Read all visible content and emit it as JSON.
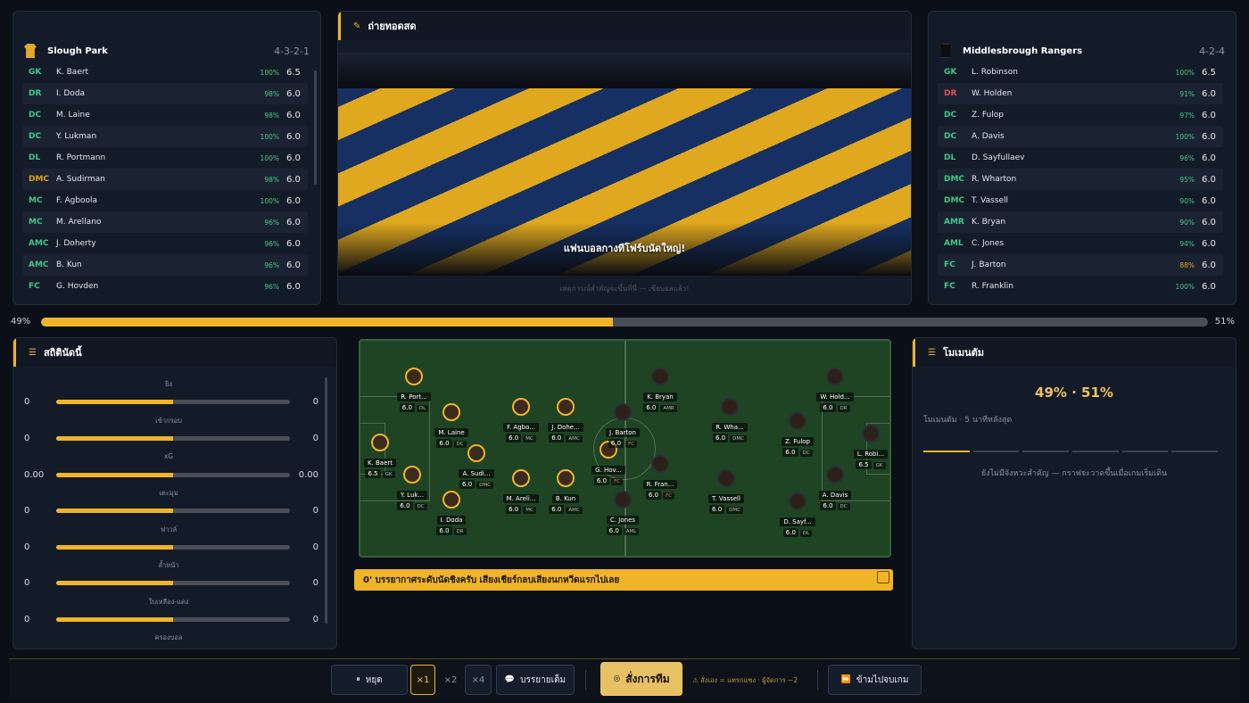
{
  "home": {
    "name": "Slough Park",
    "formation": "4-3-2-1",
    "players": [
      {
        "pos": "GK",
        "name": "K. Baert",
        "pct": "100%",
        "rating": "6.5",
        "pos_color": "#3ec98a",
        "pct_color": "#3ec98a"
      },
      {
        "pos": "DR",
        "name": "I. Doda",
        "pct": "98%",
        "rating": "6.0",
        "pos_color": "#3ec98a",
        "pct_color": "#3ec98a"
      },
      {
        "pos": "DC",
        "name": "M. Laine",
        "pct": "98%",
        "rating": "6.0",
        "pos_color": "#3ec98a",
        "pct_color": "#3ec98a"
      },
      {
        "pos": "DC",
        "name": "Y. Lukman",
        "pct": "100%",
        "rating": "6.0",
        "pos_color": "#3ec98a",
        "pct_color": "#3ec98a"
      },
      {
        "pos": "DL",
        "name": "R. Portmann",
        "pct": "100%",
        "rating": "6.0",
        "pos_color": "#3ec98a",
        "pct_color": "#3ec98a"
      },
      {
        "pos": "DMC",
        "name": "A. Sudirman",
        "pct": "98%",
        "rating": "6.0",
        "pos_color": "#e0a020",
        "pct_color": "#3ec98a"
      },
      {
        "pos": "MC",
        "name": "F. Agboola",
        "pct": "100%",
        "rating": "6.0",
        "pos_color": "#3ec98a",
        "pct_color": "#3ec98a"
      },
      {
        "pos": "MC",
        "name": "M. Arellano",
        "pct": "96%",
        "rating": "6.0",
        "pos_color": "#3ec98a",
        "pct_color": "#3ec98a"
      },
      {
        "pos": "AMC",
        "name": "J. Doherty",
        "pct": "96%",
        "rating": "6.0",
        "pos_color": "#3ec98a",
        "pct_color": "#3ec98a"
      },
      {
        "pos": "AMC",
        "name": "B. Kun",
        "pct": "96%",
        "rating": "6.0",
        "pos_color": "#3ec98a",
        "pct_color": "#3ec98a"
      },
      {
        "pos": "FC",
        "name": "G. Hovden",
        "pct": "96%",
        "rating": "6.0",
        "pos_color": "#3ec98a",
        "pct_color": "#3ec98a"
      }
    ]
  },
  "away": {
    "name": "Middlesbrough Rangers",
    "formation": "4-2-4",
    "players": [
      {
        "pos": "GK",
        "name": "L. Robinson",
        "pct": "100%",
        "rating": "6.5",
        "pos_color": "#3ec98a",
        "pct_color": "#3ec98a"
      },
      {
        "pos": "DR",
        "name": "W. Holden",
        "pct": "91%",
        "rating": "6.0",
        "pos_color": "#e0505a",
        "pct_color": "#3ec98a"
      },
      {
        "pos": "DC",
        "name": "Z. Fulop",
        "pct": "97%",
        "rating": "6.0",
        "pos_color": "#3ec98a",
        "pct_color": "#3ec98a"
      },
      {
        "pos": "DC",
        "name": "A. Davis",
        "pct": "100%",
        "rating": "6.0",
        "pos_color": "#3ec98a",
        "pct_color": "#3ec98a"
      },
      {
        "pos": "DL",
        "name": "D. Sayfullaev",
        "pct": "96%",
        "rating": "6.0",
        "pos_color": "#3ec98a",
        "pct_color": "#3ec98a"
      },
      {
        "pos": "DMC",
        "name": "R. Wharton",
        "pct": "95%",
        "rating": "6.0",
        "pos_color": "#3ec98a",
        "pct_color": "#3ec98a"
      },
      {
        "pos": "DMC",
        "name": "T. Vassell",
        "pct": "90%",
        "rating": "6.0",
        "pos_color": "#3ec98a",
        "pct_color": "#3ec98a"
      },
      {
        "pos": "AMR",
        "name": "K. Bryan",
        "pct": "90%",
        "rating": "6.0",
        "pos_color": "#3ec98a",
        "pct_color": "#3ec98a"
      },
      {
        "pos": "AML",
        "name": "C. Jones",
        "pct": "94%",
        "rating": "6.0",
        "pos_color": "#3ec98a",
        "pct_color": "#3ec98a"
      },
      {
        "pos": "FC",
        "name": "J. Barton",
        "pct": "88%",
        "rating": "6.0",
        "pos_color": "#3ec98a",
        "pct_color": "#e0a020"
      },
      {
        "pos": "FC",
        "name": "R. Franklin",
        "pct": "100%",
        "rating": "6.0",
        "pos_color": "#3ec98a",
        "pct_color": "#3ec98a"
      }
    ]
  },
  "video": {
    "title": "ถ่ายทอดสด",
    "caption": "แฟนบอลกางทีโฟร์บนัดใหญ่!",
    "note": "เหตุการณ์สำคัญจะขึ้นที่นี่ — เชียบอลแล้ว!"
  },
  "momentum_bar": {
    "left": "49%",
    "right": "51%",
    "home_fraction": 0.49
  },
  "stats": {
    "title": "สถิตินัดนี้",
    "items": [
      {
        "label": "ยิง",
        "home": "0",
        "away": "0"
      },
      {
        "label": "เข้ากรอบ",
        "home": "0",
        "away": "0"
      },
      {
        "label": "xG",
        "home": "0.00",
        "away": "0.00"
      },
      {
        "label": "เตะมุม",
        "home": "0",
        "away": "0"
      },
      {
        "label": "ฟาวล์",
        "home": "0",
        "away": "0"
      },
      {
        "label": "ล้ำหน้า",
        "home": "0",
        "away": "0"
      },
      {
        "label": "ใบเหลือง-แดง",
        "home": "0",
        "away": "0"
      },
      {
        "label": "ครองบอล",
        "home": "",
        "away": ""
      }
    ]
  },
  "pitch": {
    "home_players": [
      {
        "name": "R. Port...",
        "rating": "6.0",
        "pos": "DL"
      },
      {
        "name": "M. Laine",
        "rating": "6.0",
        "pos": "DC"
      },
      {
        "name": "F. Agbo...",
        "rating": "6.0",
        "pos": "MC"
      },
      {
        "name": "J. Dohe...",
        "rating": "6.0",
        "pos": "AMC"
      },
      {
        "name": "K. Baert",
        "rating": "6.5",
        "pos": "GK"
      },
      {
        "name": "A. Sudi...",
        "rating": "6.0",
        "pos": "DMC"
      },
      {
        "name": "G. Hov...",
        "rating": "6.0",
        "pos": "FC"
      },
      {
        "name": "Y. Luk...",
        "rating": "6.0",
        "pos": "DC"
      },
      {
        "name": "M. Areli...",
        "rating": "6.0",
        "pos": "MC"
      },
      {
        "name": "B. Kun",
        "rating": "6.0",
        "pos": "AMC"
      },
      {
        "name": "I. Doda",
        "rating": "6.0",
        "pos": "DR"
      }
    ],
    "away_players": [
      {
        "name": "K. Bryan",
        "rating": "6.0",
        "pos": "AMR"
      },
      {
        "name": "W. Hold...",
        "rating": "6.0",
        "pos": "DR"
      },
      {
        "name": "J. Barton",
        "rating": "6.0",
        "pos": "FC"
      },
      {
        "name": "R. Wha...",
        "rating": "6.0",
        "pos": "DMC"
      },
      {
        "name": "Z. Fulop",
        "rating": "6.0",
        "pos": "DC"
      },
      {
        "name": "L. Robi...",
        "rating": "6.5",
        "pos": "GK"
      },
      {
        "name": "R. Fran...",
        "rating": "6.0",
        "pos": "FC"
      },
      {
        "name": "T. Vassell",
        "rating": "6.0",
        "pos": "DMC"
      },
      {
        "name": "A. Davis",
        "rating": "6.0",
        "pos": "DC"
      },
      {
        "name": "C. Jones",
        "rating": "6.0",
        "pos": "AML"
      },
      {
        "name": "D. Sayf...",
        "rating": "6.0",
        "pos": "DL"
      }
    ]
  },
  "commentary": "0' บรรยากาศระดับนัดชิงครับ เสียงเชียร์กลบเสียงนกหวีดแรกไปเลย",
  "momentum_panel": {
    "title": "โมเมนตัม",
    "big": "49% · 51%",
    "sub": "โมเมนตัม · 5 นาทีหลังสุด",
    "empty": "ยังไม่มีจังหวะสำคัญ — กราฟจะวาดขึ้นเมื่อเกมเริ่มเดิน"
  },
  "controls": {
    "pause": "หยุด",
    "speed1": "×1",
    "speed2": "×2",
    "speed4": "×4",
    "commentary": "บรรยายเต็ม",
    "tactics": "สั่งการทีม",
    "hint": "สั่งเอง = แทรกแซง · ผู้จัดการ ~2",
    "skip": "ข้ามไปจบเกม"
  },
  "colors": {
    "accent": "#f0b429",
    "panel": "#141b28",
    "pitch": "#1e4423"
  },
  "icons": {
    "pause": "pause-icon",
    "commentary": "speech-bubble-icon",
    "tactics": "target-icon",
    "skip": "fast-forward-icon",
    "warning": "warning-icon"
  }
}
